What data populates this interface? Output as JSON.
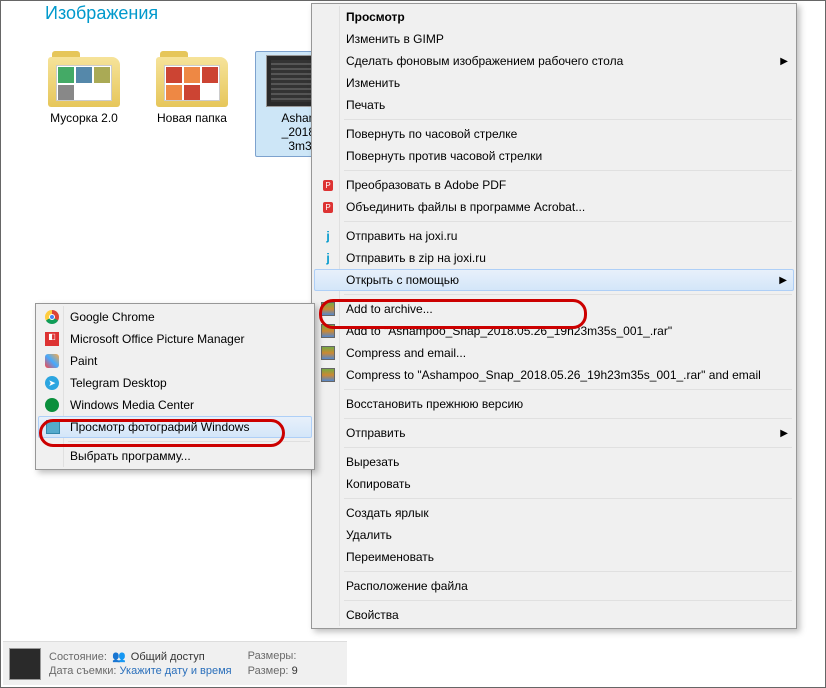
{
  "header": {
    "title": "Изображения"
  },
  "folders": [
    {
      "label": "Мусорка 2.0"
    },
    {
      "label": "Новая папка"
    },
    {
      "label": "Asham\n_2018.\n3m3"
    }
  ],
  "main_menu": {
    "items": [
      {
        "label": "Просмотр",
        "bold": true
      },
      {
        "label": "Изменить в GIMP"
      },
      {
        "label": "Сделать фоновым изображением рабочего стола",
        "submenu": true
      },
      {
        "label": "Изменить"
      },
      {
        "label": "Печать"
      },
      {
        "sep": true
      },
      {
        "label": "Повернуть по часовой стрелке"
      },
      {
        "label": "Повернуть против часовой стрелки"
      },
      {
        "sep": true
      },
      {
        "label": "Преобразовать в Adobe PDF",
        "icon": "pdf"
      },
      {
        "label": "Объединить файлы в программе Acrobat...",
        "icon": "pdf"
      },
      {
        "sep": true
      },
      {
        "label": "Отправить на joxi.ru",
        "icon": "joxi"
      },
      {
        "label": "Отправить в zip на joxi.ru",
        "icon": "joxi"
      },
      {
        "label": "Открыть с помощью",
        "submenu": true,
        "highlighted": true
      },
      {
        "sep": true
      },
      {
        "label": "Add to archive...",
        "icon": "rar"
      },
      {
        "label": "Add to \"Ashampoo_Snap_2018.05.26_19h23m35s_001_.rar\"",
        "icon": "rar"
      },
      {
        "label": "Compress and email...",
        "icon": "rar"
      },
      {
        "label": "Compress to \"Ashampoo_Snap_2018.05.26_19h23m35s_001_.rar\" and email",
        "icon": "rar"
      },
      {
        "sep": true
      },
      {
        "label": "Восстановить прежнюю версию"
      },
      {
        "sep": true
      },
      {
        "label": "Отправить",
        "submenu": true
      },
      {
        "sep": true
      },
      {
        "label": "Вырезать"
      },
      {
        "label": "Копировать"
      },
      {
        "sep": true
      },
      {
        "label": "Создать ярлык"
      },
      {
        "label": "Удалить"
      },
      {
        "label": "Переименовать"
      },
      {
        "sep": true
      },
      {
        "label": "Расположение файла"
      },
      {
        "sep": true
      },
      {
        "label": "Свойства"
      }
    ]
  },
  "sub_menu": {
    "items": [
      {
        "label": "Google Chrome",
        "icon": "chrome"
      },
      {
        "label": "Microsoft Office Picture Manager",
        "icon": "mspm"
      },
      {
        "label": "Paint",
        "icon": "paint"
      },
      {
        "label": "Telegram Desktop",
        "icon": "telegram"
      },
      {
        "label": "Windows Media Center",
        "icon": "wmc"
      },
      {
        "label": "Просмотр фотографий Windows",
        "icon": "photoviewer",
        "highlighted": true
      },
      {
        "sep": true
      },
      {
        "label": "Выбрать программу..."
      }
    ]
  },
  "status": {
    "state_label": "Состояние:",
    "state_icon": "shared",
    "state_value": "Общий доступ",
    "date_label": "Дата съемки:",
    "date_value": "Укажите дату и время",
    "size_label": "Размеры:",
    "size_value": "",
    "size2_label": "Размер:",
    "size2_value": "9"
  }
}
